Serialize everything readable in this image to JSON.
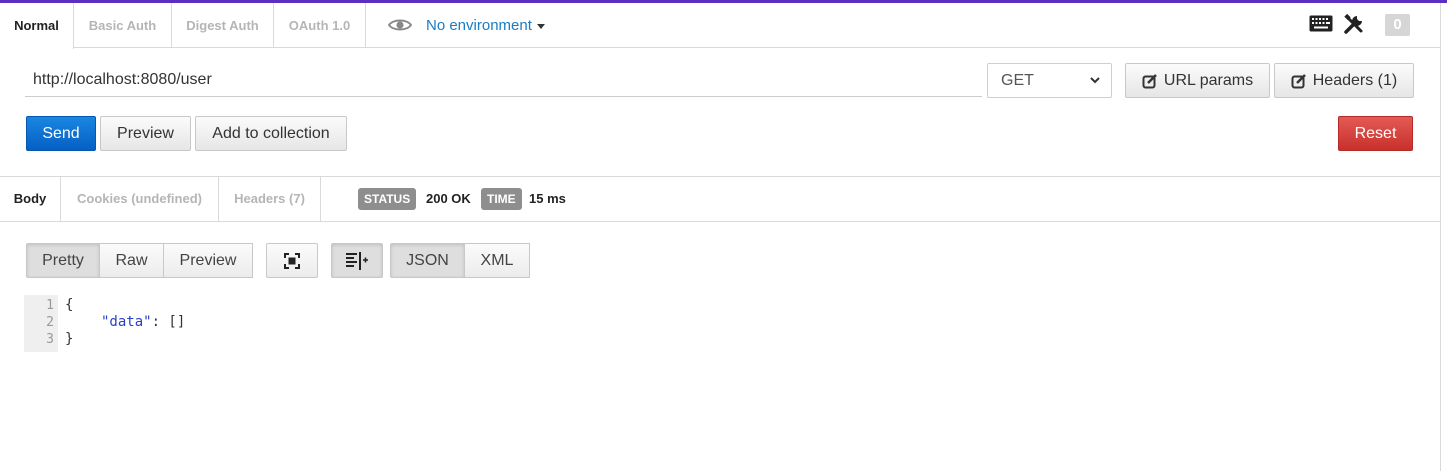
{
  "auth_tabs": [
    {
      "label": "Normal",
      "active": true
    },
    {
      "label": "Basic Auth",
      "active": false
    },
    {
      "label": "Digest Auth",
      "active": false
    },
    {
      "label": "OAuth 1.0",
      "active": false
    }
  ],
  "environment": {
    "label": "No environment",
    "icon": "eye-icon"
  },
  "toolbar": {
    "keyboard_icon": "keyboard-icon",
    "tools_icon": "wrench-icon",
    "counter": "0"
  },
  "request": {
    "url": "http://localhost:8080/user",
    "method": "GET",
    "url_params_label": "URL params",
    "headers_label": "Headers (1)"
  },
  "actions": {
    "send": "Send",
    "preview": "Preview",
    "add_to_collection": "Add to collection",
    "reset": "Reset"
  },
  "response_tabs": [
    {
      "label": "Body",
      "active": true
    },
    {
      "label": "Cookies (undefined)",
      "active": false
    },
    {
      "label": "Headers (7)",
      "active": false
    }
  ],
  "status": {
    "status_label": "STATUS",
    "status_value": "200 OK",
    "time_label": "TIME",
    "time_value": "15 ms"
  },
  "view_modes": {
    "pretty": "Pretty",
    "raw": "Raw",
    "preview": "Preview",
    "json": "JSON",
    "xml": "XML"
  },
  "body": {
    "line_numbers": [
      "1",
      "2",
      "3"
    ],
    "line1": "{",
    "line2_key": "\"data\"",
    "line2_rest": ": []",
    "line3": "}"
  },
  "colors": {
    "accent": "#5b2fc2",
    "send": "#0a6fd4",
    "reset": "#d43f3a",
    "link": "#1a7cc2"
  }
}
